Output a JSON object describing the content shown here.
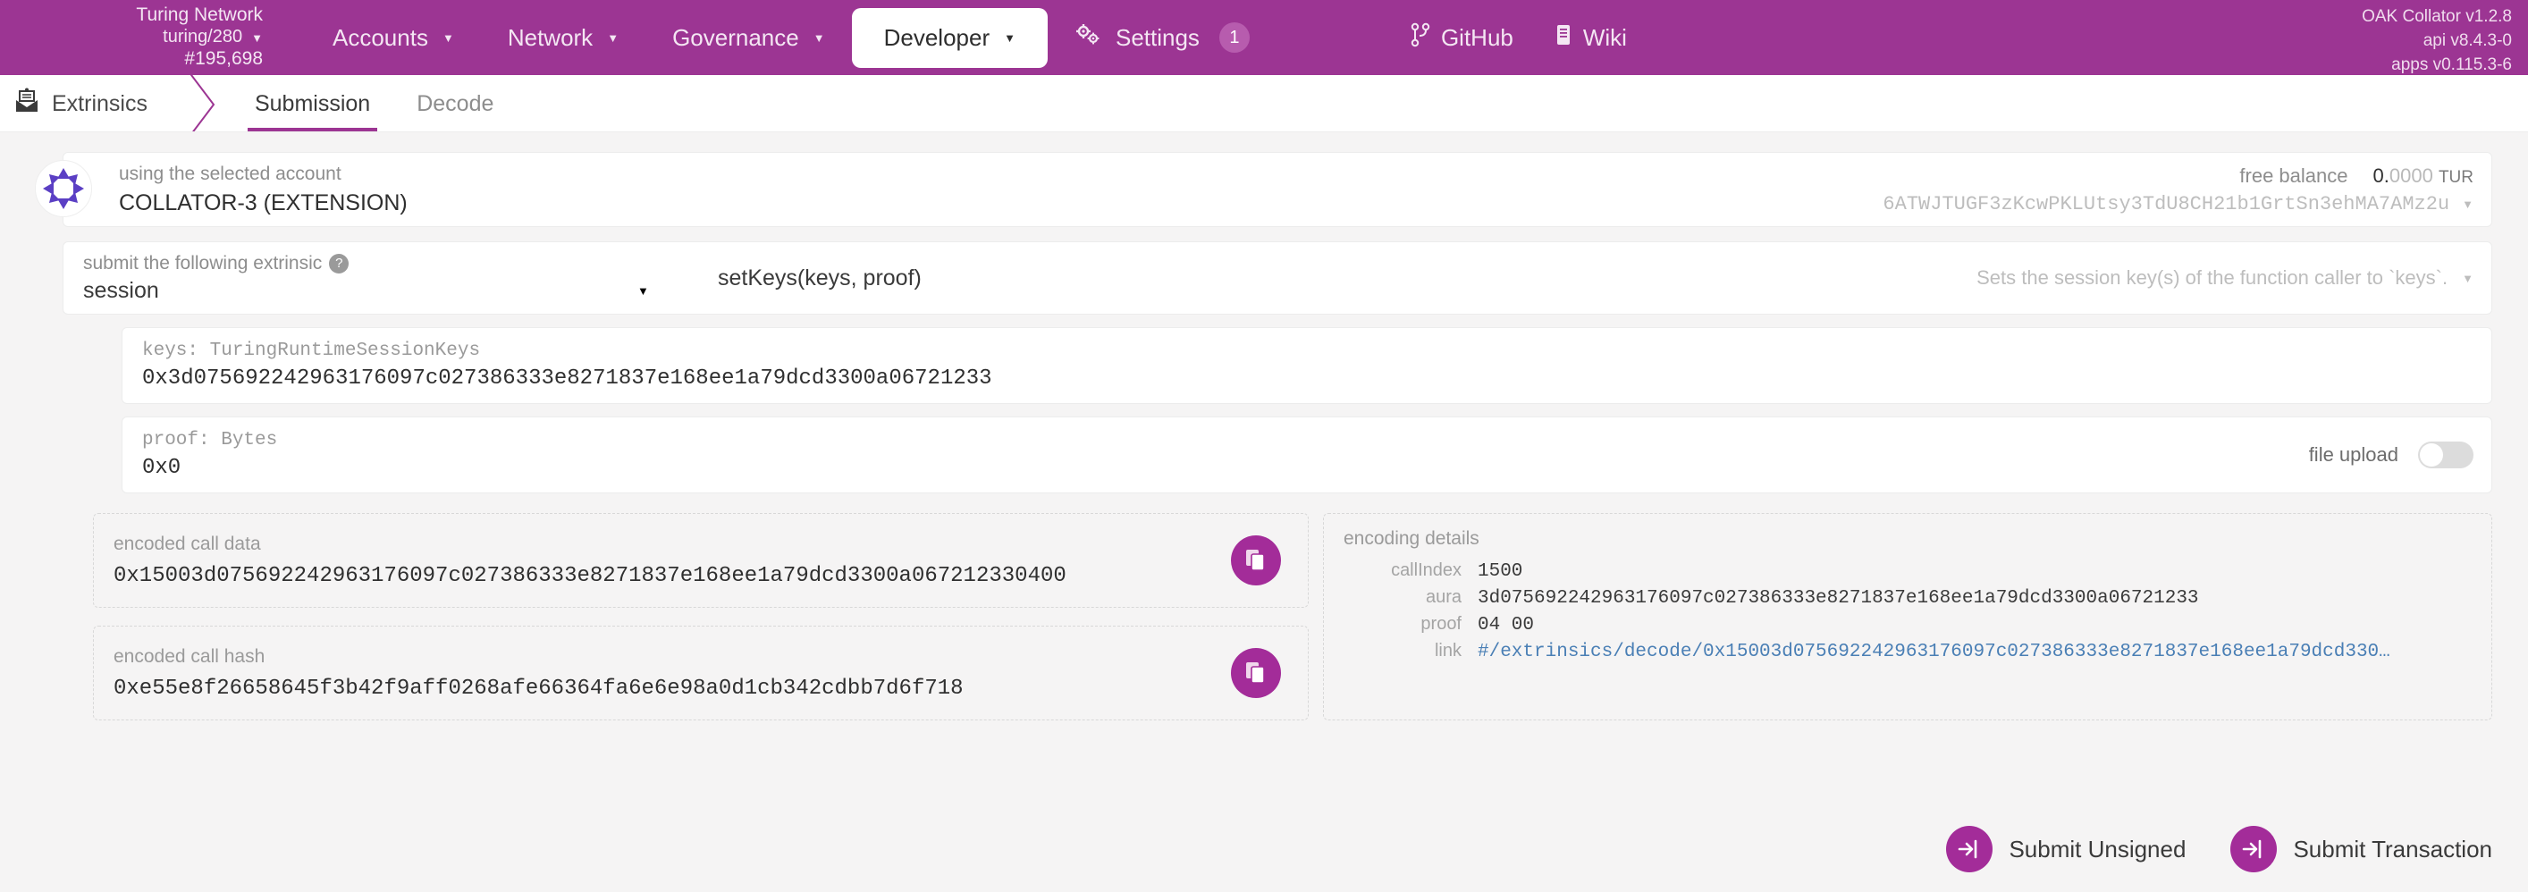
{
  "topbar": {
    "chain": {
      "name": "Turing Network",
      "spec": "turing/280",
      "block": "#195,698"
    },
    "menu": [
      {
        "label": "Accounts",
        "icon": "chevron-down-icon",
        "active": false
      },
      {
        "label": "Network",
        "icon": "chevron-down-icon",
        "active": false
      },
      {
        "label": "Governance",
        "icon": "chevron-down-icon",
        "active": false
      },
      {
        "label": "Developer",
        "icon": "chevron-down-icon",
        "active": true
      },
      {
        "label": "Settings",
        "icon": "gears-icon",
        "badge": "1",
        "active": false
      }
    ],
    "links": [
      {
        "label": "GitHub",
        "icon": "git-branch-icon"
      },
      {
        "label": "Wiki",
        "icon": "book-icon"
      }
    ],
    "versions": {
      "node": "OAK Collator v1.2.8",
      "api": "api v8.4.3-0",
      "apps": "apps v0.115.3-6"
    }
  },
  "tabbar": {
    "section": "Extrinsics",
    "section_icon": "mail-open-icon",
    "tabs": [
      {
        "label": "Submission",
        "active": true
      },
      {
        "label": "Decode",
        "active": false
      }
    ]
  },
  "account": {
    "label": "using the selected account",
    "name": "COLLATOR-3 (EXTENSION)",
    "balance_label": "free balance",
    "balance_whole": "0.",
    "balance_decimals": "0000",
    "balance_unit": "TUR",
    "address": "6ATWJTUGF3zKcwPKLUtsy3TdU8CH21b1GrtSn3ehMA7AMz2u"
  },
  "extrinsic": {
    "label": "submit the following extrinsic",
    "help_icon": "question-mark-icon",
    "module": "session",
    "method": "setKeys(keys, proof)",
    "docs": "Sets the session key(s) of the function caller to `keys`."
  },
  "args": [
    {
      "label": "keys: TuringRuntimeSessionKeys",
      "value": "0x3d075692242963176097c027386333e8271837e168ee1a79dcd3300a06721233",
      "has_toggle": false
    },
    {
      "label": "proof: Bytes",
      "value": "0x0",
      "has_toggle": true,
      "toggle_label": "file upload",
      "toggle_on": false
    }
  ],
  "encoded": [
    {
      "label": "encoded call data",
      "value": "0x15003d075692242963176097c027386333e8271837e168ee1a79dcd3300a067212330400",
      "copy_icon": "copy-icon"
    },
    {
      "label": "encoded call hash",
      "value": "0xe55e8f26658645f3b42f9aff0268afe66364fa6e6e98a0d1cb342cdbb7d6f718",
      "copy_icon": "copy-icon"
    }
  ],
  "details": {
    "title": "encoding details",
    "rows": [
      {
        "key": "callIndex",
        "value": "1500",
        "is_link": false
      },
      {
        "key": "aura",
        "value": "3d075692242963176097c027386333e8271837e168ee1a79dcd3300a06721233",
        "is_link": false
      },
      {
        "key": "proof",
        "value": "04 00",
        "is_link": false
      },
      {
        "key": "link",
        "value": "#/extrinsics/decode/0x15003d075692242963176097c027386333e8271837e168ee1a79dcd330…",
        "is_link": true
      }
    ]
  },
  "footer": {
    "buttons": [
      {
        "label": "Submit Unsigned",
        "icon": "sign-in-icon"
      },
      {
        "label": "Submit Transaction",
        "icon": "sign-in-icon"
      }
    ]
  },
  "colors": {
    "brand": "#9c3593",
    "accent": "#a32c99",
    "link": "#4a7fb5",
    "page_bg": "#f5f4f4"
  }
}
